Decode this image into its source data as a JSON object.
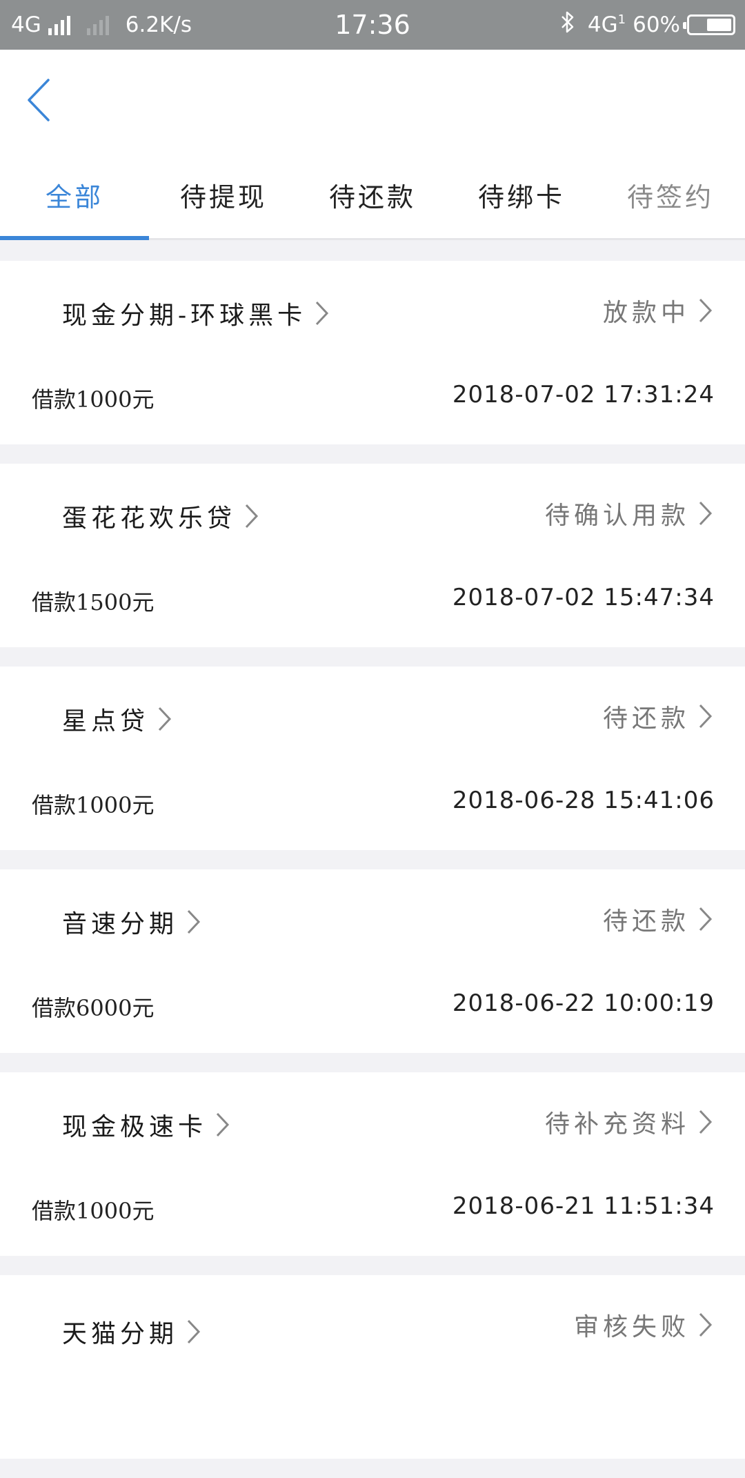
{
  "status_bar": {
    "network": "4G",
    "speed": "6.2K/s",
    "time": "17:36",
    "network_right": "4G",
    "network_sub": "1",
    "battery": "60%"
  },
  "header": {
    "back_icon": "chevron-left-icon"
  },
  "tabs": [
    {
      "label": "全部"
    },
    {
      "label": "待提现"
    },
    {
      "label": "待还款"
    },
    {
      "label": "待绑卡"
    },
    {
      "label": "待签约"
    }
  ],
  "loans": [
    {
      "name": "现金分期-环球黑卡",
      "status": "放款中",
      "amount": "借款1000元",
      "time": "2018-07-02 17:31:24"
    },
    {
      "name": "蛋花花欢乐贷",
      "status": "待确认用款",
      "amount": "借款1500元",
      "time": "2018-07-02 15:47:34"
    },
    {
      "name": "星点贷",
      "status": "待还款",
      "amount": "借款1000元",
      "time": "2018-06-28 15:41:06"
    },
    {
      "name": "音速分期",
      "status": "待还款",
      "amount": "借款6000元",
      "time": "2018-06-22 10:00:19"
    },
    {
      "name": "现金极速卡",
      "status": "待补充资料",
      "amount": "借款1000元",
      "time": "2018-06-21 11:51:34"
    },
    {
      "name": "天猫分期",
      "status": "审核失败",
      "amount": "",
      "time": ""
    }
  ],
  "colors": {
    "accent": "#3b86d8",
    "status_bar": "#8d9091",
    "background": "#f2f2f5"
  }
}
